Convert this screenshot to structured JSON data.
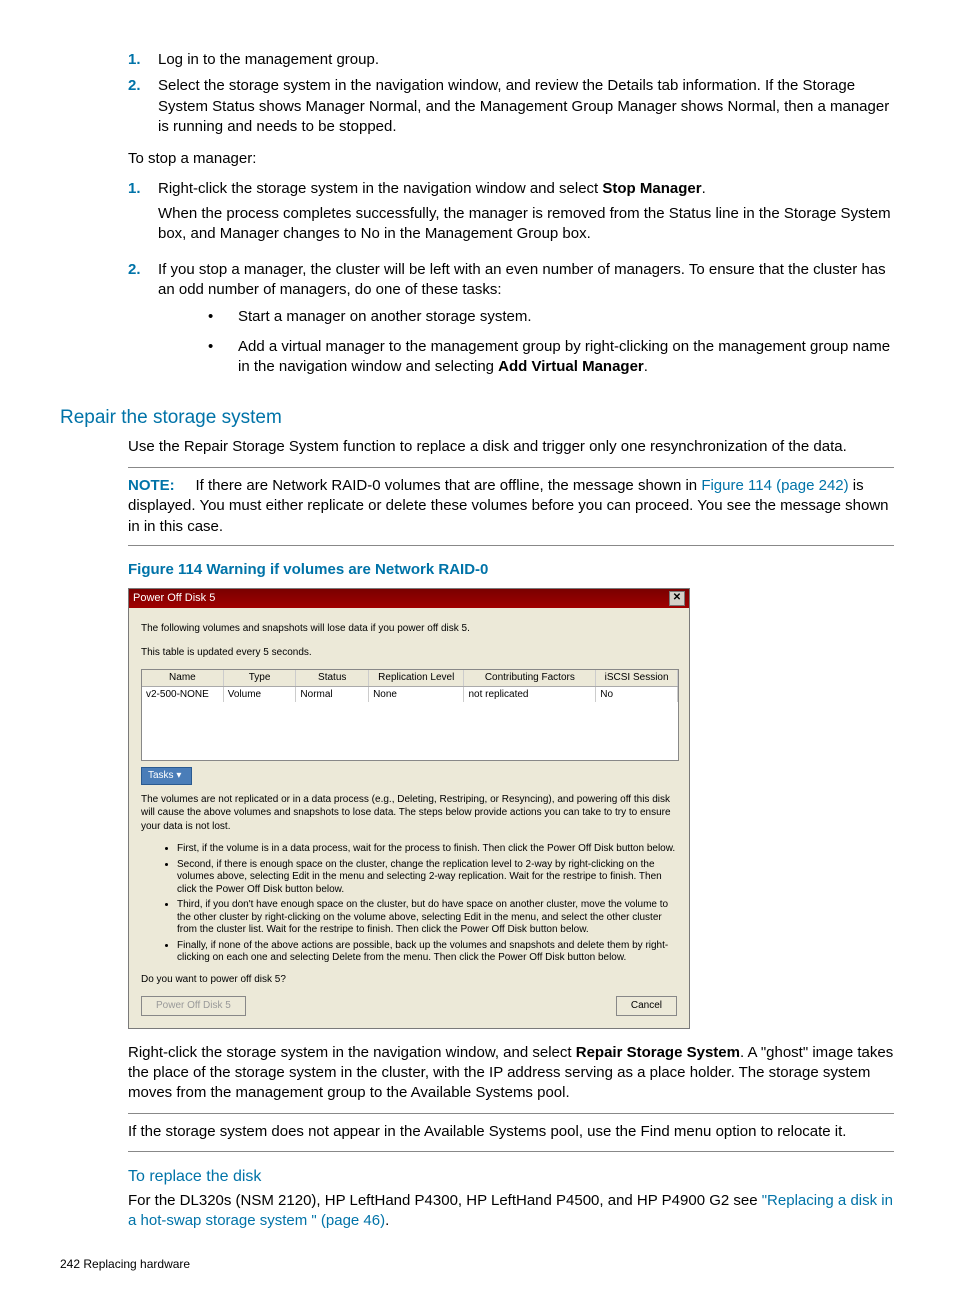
{
  "list1": {
    "n1": "1.",
    "t1": "Log in to the management group.",
    "n2": "2.",
    "t2": "Select the storage system in the navigation window, and review the Details tab information. If the Storage System Status shows Manager Normal, and the Management Group Manager shows Normal, then a manager is running and needs to be stopped."
  },
  "stop_intro": "To stop a manager:",
  "list2": {
    "n1": "1.",
    "t1a": "Right-click the storage system in the navigation window and select ",
    "t1b": "Stop Manager",
    "t1c": ".",
    "t1d": "When the process completes successfully, the manager is removed from the Status line in the Storage System box, and Manager changes to No in the Management Group box.",
    "n2": "2.",
    "t2": "If you stop a manager, the cluster will be left with an even number of managers. To ensure that the cluster has an odd number of managers, do one of these tasks:",
    "b1": "Start a manager on another storage system.",
    "b2a": "Add a virtual manager to the management group by right-clicking on the management group name in the navigation window and selecting ",
    "b2b": "Add Virtual Manager",
    "b2c": "."
  },
  "h_repair": "Repair the storage system",
  "repair_p": "Use the Repair Storage System function to replace a disk and trigger only one resynchronization of the data.",
  "note": {
    "label": "NOTE:",
    "t1": "If there are Network RAID-0 volumes that are offline, the message shown in ",
    "link": "Figure 114 (page 242)",
    "t2": " is displayed. You must either replicate or delete these volumes before you can proceed. You see the message shown in in this case."
  },
  "figcap": "Figure 114 Warning if volumes are Network RAID-0",
  "dlg": {
    "title": "Power Off Disk 5",
    "close": "✕",
    "p1": "The following volumes and snapshots will lose data if you power off disk 5.",
    "p2": "This table is updated every 5 seconds.",
    "head": {
      "c1": "Name",
      "c2": "Type",
      "c3": "Status",
      "c4": "Replication Level",
      "c5": "Contributing Factors",
      "c6": "iSCSI Session"
    },
    "row": {
      "c1": "v2-500-NONE",
      "c2": "Volume",
      "c3": "Normal",
      "c4": "None",
      "c5": "not replicated",
      "c6": "No"
    },
    "tasks": "Tasks ▾",
    "p3": "The volumes are not replicated or in a data process (e.g., Deleting, Restriping, or Resyncing), and powering off this disk will cause the above volumes and snapshots to lose data. The steps below provide actions you can take to try to ensure your data is not lost.",
    "li1": "First, if the volume is in a data process, wait for the process to finish. Then click the Power Off Disk button below.",
    "li2": "Second, if there is enough space on the cluster, change the replication level to 2-way by right-clicking on the volumes above, selecting Edit in the menu and selecting 2-way replication. Wait for the restripe to finish. Then click the Power Off Disk button below.",
    "li3": "Third, if you don't have enough space on the cluster, but do have space on another cluster, move the volume to the other cluster by right-clicking on the volume above, selecting Edit in the menu, and select the other cluster from the cluster list. Wait for the restripe to finish. Then click the Power Off Disk button below.",
    "li4": "Finally, if none of the above actions are possible, back up the volumes and snapshots and delete them by right-clicking on each one and selecting Delete from the menu. Then click the Power Off Disk button below.",
    "q": "Do you want to power off disk 5?",
    "btn1": "Power Off Disk 5",
    "btn2": "Cancel"
  },
  "after1a": "Right-click the storage system in the navigation window, and select ",
  "after1b": "Repair Storage System",
  "after1c": ". A \"ghost\" image takes the place of the storage system in the cluster, with the IP address serving as a place holder. The storage system moves from the management group to the Available Systems pool.",
  "after2": "If the storage system does not appear in the Available Systems pool, use the Find menu option to relocate it.",
  "h_replace": "To replace the disk",
  "replace_p1": "For the DL320s (NSM 2120), HP LeftHand P4300, HP LeftHand P4500, and HP P4900 G2 see ",
  "replace_link": "\"Replacing a disk in a hot-swap storage system \" (page 46)",
  "replace_p2": ".",
  "footer": "242   Replacing hardware"
}
